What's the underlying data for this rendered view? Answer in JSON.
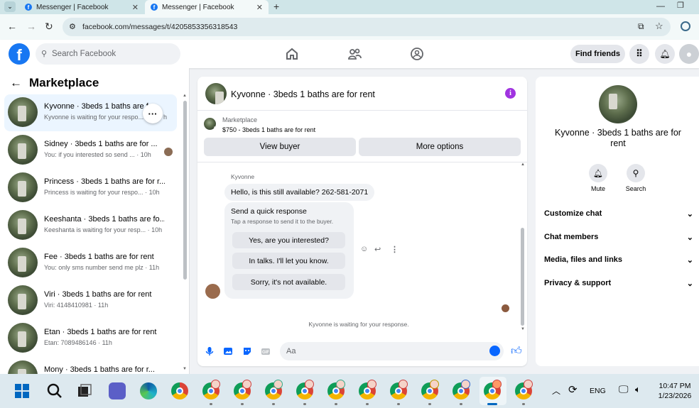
{
  "browser": {
    "tabs": [
      {
        "title": "Messenger | Facebook",
        "active": false
      },
      {
        "title": "Messenger | Facebook",
        "active": true
      }
    ],
    "url": "facebook.com/messages/t/4205853356318543"
  },
  "fb_header": {
    "logo": "f",
    "search_placeholder": "Search Facebook",
    "find_friends": "Find friends",
    "nav_icons": [
      "home-icon",
      "friends-icon",
      "groups-icon"
    ]
  },
  "sidebar": {
    "title": "Marketplace",
    "conversations": [
      {
        "name": "Kyvonne · 3beds 1 baths are fo...",
        "preview": "Kyvonne is waiting for your respo...",
        "time": "h",
        "selected": true
      },
      {
        "name": "Sidney · 3beds 1 baths are for ...",
        "preview": "You: if you interested so send ...",
        "time": "· 10h",
        "selected": false
      },
      {
        "name": "Princess · 3beds 1 baths are for r...",
        "preview": "Princess is waiting for your respo...",
        "time": "· 10h",
        "selected": false
      },
      {
        "name": "Keeshanta · 3beds 1 baths are fo...",
        "preview": "Keeshanta is waiting for your resp...",
        "time": "· 10h",
        "selected": false
      },
      {
        "name": "Fee · 3beds 1 baths are for rent",
        "preview": "You: only sms number send me plz",
        "time": "· 11h",
        "selected": false
      },
      {
        "name": "Viri · 3beds 1 baths are for rent",
        "preview": "Viri: 4148410981",
        "time": "· 11h",
        "selected": false
      },
      {
        "name": "Etan · 3beds 1 baths are for rent",
        "preview": "Etan: 7089486146",
        "time": "· 11h",
        "selected": false
      },
      {
        "name": "Mony · 3beds 1 baths are for r...",
        "preview": "",
        "time": "",
        "selected": false
      }
    ]
  },
  "chat": {
    "title": "Kyvonne · 3beds 1 baths are for rent",
    "marketplace_label": "Marketplace",
    "listing": "$750 - 3beds 1 baths are for rent",
    "view_buyer": "View buyer",
    "more_options": "More options",
    "sender": "Kyvonne",
    "message": "Hello, is this still available? 262-581-2071",
    "quick_title": "Send a quick response",
    "quick_sub": "Tap a response to send it to the buyer.",
    "quick_options": [
      "Yes, are you interested?",
      "In talks. I'll let you know.",
      "Sorry, it's not available."
    ],
    "waiting": "Kyvonne is waiting for your response.",
    "composer_placeholder": "Aa"
  },
  "details": {
    "title": "Kyvonne · 3beds 1 baths are for rent",
    "actions": [
      {
        "label": "Mute",
        "icon": "bell-icon"
      },
      {
        "label": "Search",
        "icon": "search-icon"
      }
    ],
    "sections": [
      "Customize chat",
      "Chat members",
      "Media, files and links",
      "Privacy & support"
    ]
  },
  "taskbar": {
    "language": "ENG",
    "time": "10:47 PM",
    "date": "1/23/2026"
  },
  "colors": {
    "brand": "#1877f2",
    "messenger_blue": "#0866ff",
    "info_purple": "#a033e0"
  }
}
